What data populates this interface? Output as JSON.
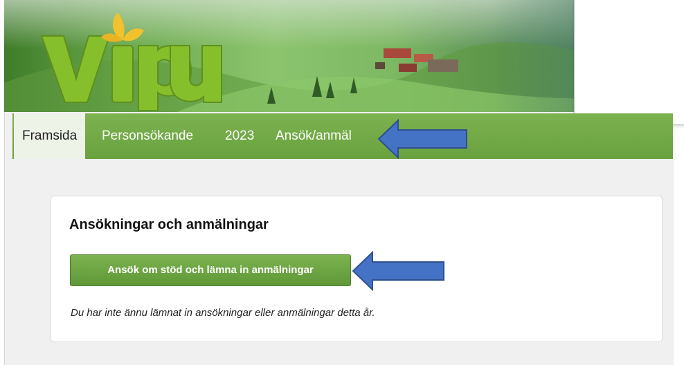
{
  "app": {
    "logo_text": "vipu"
  },
  "nav": {
    "items": [
      {
        "label": "Framsida",
        "active": true
      },
      {
        "label": "Personsökande",
        "active": false
      },
      {
        "label": "2023",
        "active": false
      },
      {
        "label": "Ansök/anmäl",
        "active": false
      }
    ]
  },
  "applications": {
    "title": "Ansökningar och anmälningar",
    "apply_button_label": "Ansök om stöd och lämna in anmälningar",
    "empty_note": "Du har inte ännu lämnat in ansökningar eller anmälningar detta år."
  },
  "colors": {
    "nav_green": "#6aa240",
    "button_green": "#5f9838",
    "annotation_arrow": "#4472c4",
    "annotation_arrow_border": "#2f4f8f"
  },
  "icons": [
    "vipu-logo",
    "leaf-icon",
    "annotation-arrow-left"
  ]
}
